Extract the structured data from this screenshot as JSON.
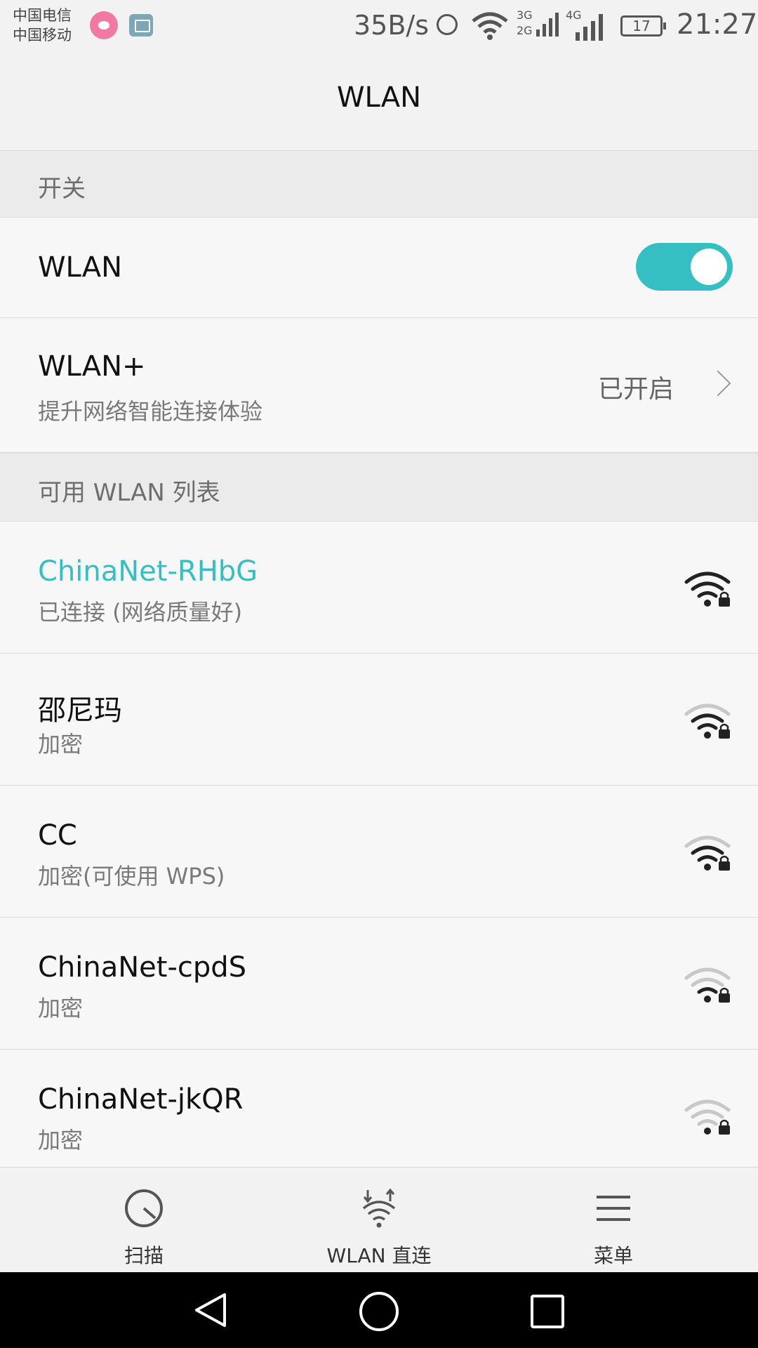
{
  "status_bar": {
    "carrier_1": "中国电信",
    "carrier_2": "中国移动",
    "net_speed": "35B/s",
    "network_3g": "3G",
    "network_2g": "2G",
    "network_4g": "4G",
    "battery": "17",
    "time": "21:27"
  },
  "header": {
    "title": "WLAN"
  },
  "switch_section": {
    "header": "开关",
    "wlan_label": "WLAN",
    "wlan_on": true
  },
  "wlan_plus": {
    "title": "WLAN+",
    "subtitle": "提升网络智能连接体验",
    "status": "已开启"
  },
  "available_section": {
    "header": "可用 WLAN 列表"
  },
  "networks": [
    {
      "name": "ChinaNet-RHbG",
      "status": "已连接 (网络质量好)",
      "connected": true,
      "signal_level": 4
    },
    {
      "name": "邵尼玛",
      "status": "加密",
      "connected": false,
      "signal_level": 3
    },
    {
      "name": "CC",
      "status": "加密(可使用 WPS)",
      "connected": false,
      "signal_level": 3
    },
    {
      "name": "ChinaNet-cpdS",
      "status": "加密",
      "connected": false,
      "signal_level": 2
    },
    {
      "name": "ChinaNet-jkQR",
      "status": "加密",
      "connected": false,
      "signal_level": 1
    }
  ],
  "actions": {
    "scan": "扫描",
    "direct": "WLAN 直连",
    "menu": "菜单"
  },
  "colors": {
    "accent": "#35bfc2",
    "navbar": "#000000"
  }
}
